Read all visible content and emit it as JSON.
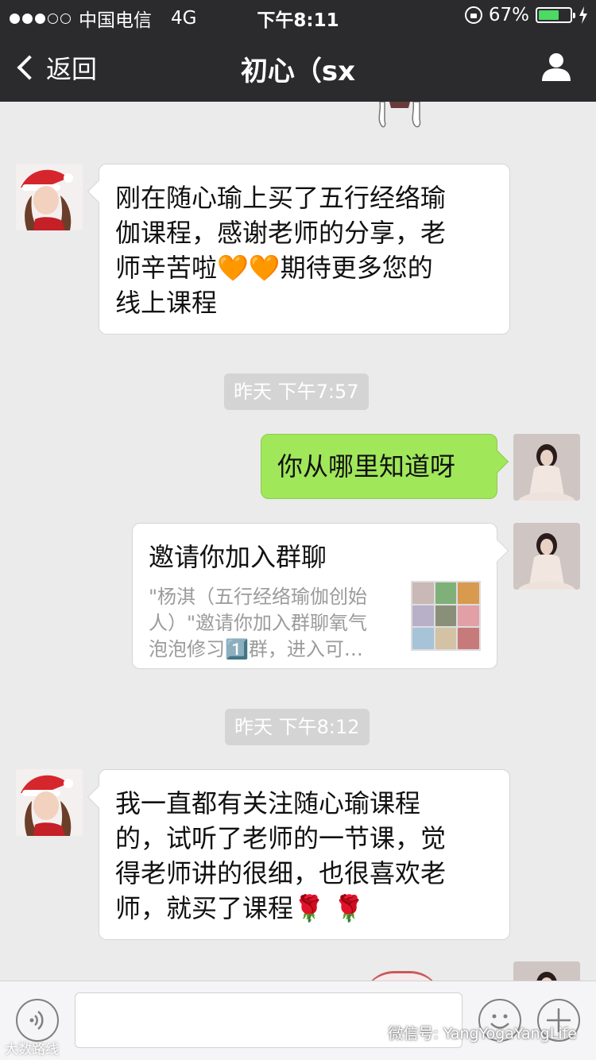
{
  "status_bar": {
    "carrier": "中国电信",
    "network": "4G",
    "time": "下午8:11",
    "battery_percent": "67%",
    "battery_level": 0.67
  },
  "nav": {
    "back_label": "返回",
    "title": "初心（sx"
  },
  "messages": [
    {
      "from": "other",
      "text_lines": [
        "刚在随心瑜上买了五行经络瑜",
        "伽课程，感谢老师的分享，老",
        "师辛苦啦🧡🧡期待更多您的",
        "线上课程"
      ]
    },
    {
      "timestamp": "昨天 下午7:57"
    },
    {
      "from": "me",
      "text": "你从哪里知道呀"
    },
    {
      "from": "me",
      "type": "group_invite",
      "title": "邀请你加入群聊",
      "desc_lines": [
        "\"杨淇（五行经络瑜伽创始",
        "人）\"邀请你加入群聊氧气",
        "泡泡修习1️⃣群，进入可…"
      ]
    },
    {
      "timestamp": "昨天 下午8:12"
    },
    {
      "from": "other",
      "text_lines": [
        "我一直都有关注随心瑜课程",
        "的，试听了老师的一节课，觉",
        "得老师讲的很细，也很喜欢老",
        "师，就买了课程🌹 🌹"
      ]
    }
  ],
  "watermark": {
    "text": "微信号: YangYogaYangLife",
    "left_text": "大数路线"
  },
  "colors": {
    "bar_bg": "#2b2b2e",
    "chat_bg": "#ebebeb",
    "green_bubble": "#a0e75a",
    "battery": "#4cd964"
  }
}
